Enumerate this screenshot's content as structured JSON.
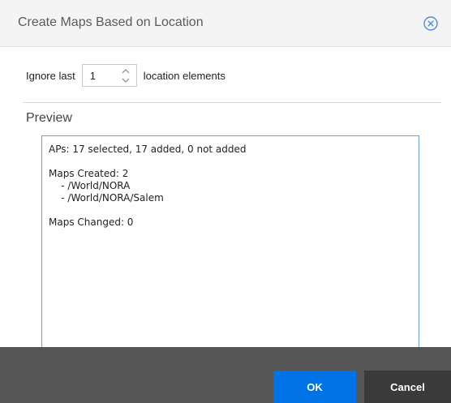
{
  "dialog": {
    "title": "Create Maps Based on Location",
    "close_icon": "close-circle-icon"
  },
  "ignore": {
    "prefix_label": "Ignore last",
    "value": "1",
    "suffix_label": "location elements"
  },
  "preview": {
    "label": "Preview",
    "lines": {
      "aps": "APs: 17 selected, 17 added, 0 not added",
      "maps_created": "Maps Created: 2",
      "map_1": "    - /World/NORA",
      "map_2": "    - /World/NORA/Salem",
      "maps_changed": "Maps Changed: 0"
    }
  },
  "buttons": {
    "ok_label": "OK",
    "cancel_label": "Cancel"
  },
  "colors": {
    "accent": "#0073e6",
    "footer": "#565656",
    "cancel": "#3a3a3a",
    "preview_border": "#6b9fd6"
  }
}
